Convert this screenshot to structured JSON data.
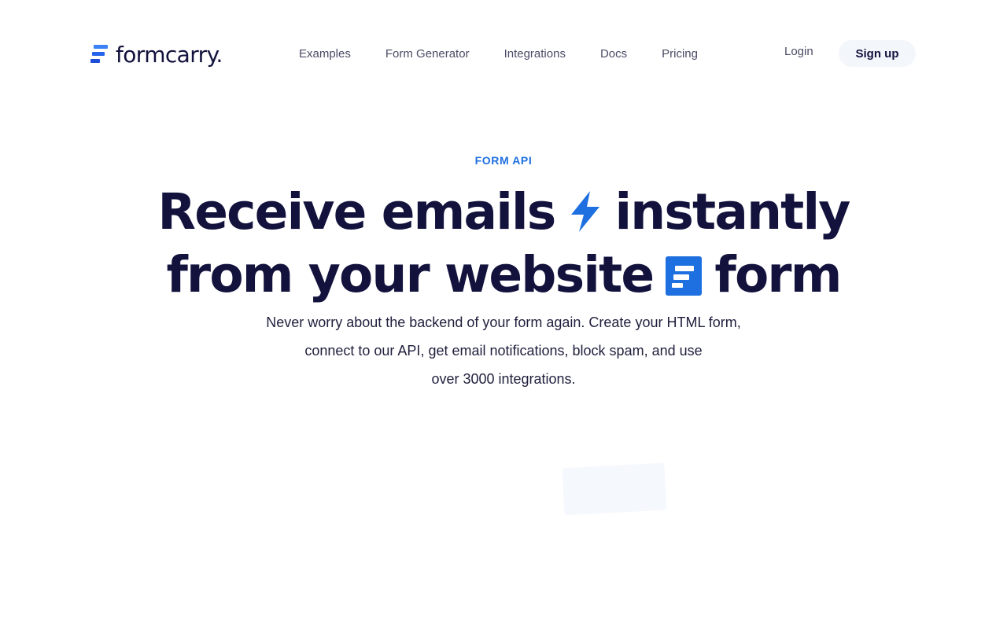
{
  "brand": {
    "name": "formcarry.",
    "accent": "#1e6fe0",
    "dark": "#12123d"
  },
  "nav": {
    "items": [
      "Examples",
      "Form Generator",
      "Integrations",
      "Docs",
      "Pricing"
    ],
    "login": "Login",
    "signup": "Sign up"
  },
  "hero": {
    "eyebrow": "FORM API",
    "line1_a": "Receive emails",
    "line1_b": "instantly",
    "line2_a": "from your website",
    "line2_b": "form",
    "icon_1": "lightning-bolt-icon",
    "icon_2": "form-square-icon",
    "subtitle": [
      "Never worry about the backend of your form again. Create your HTML form,",
      "connect to our API, get email notifications, block spam, and use",
      "over 3000 integrations."
    ]
  }
}
